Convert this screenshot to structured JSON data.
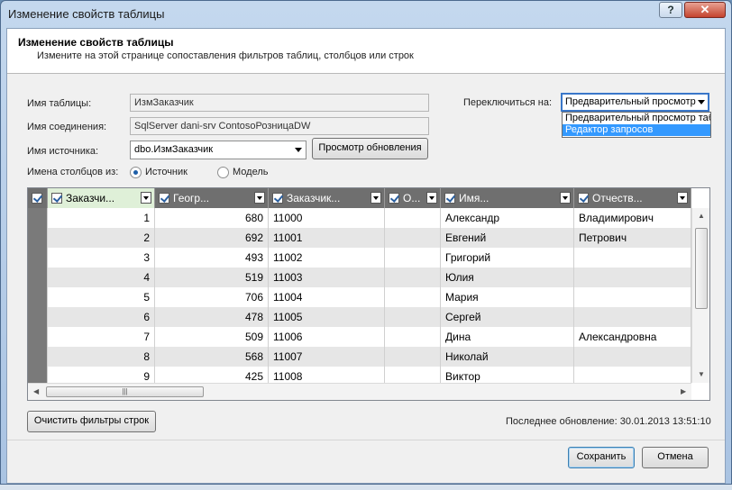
{
  "window": {
    "title": "Изменение свойств таблицы",
    "help_label": "?",
    "close_label": "✕"
  },
  "header": {
    "title": "Изменение свойств таблицы",
    "subtitle": "Измените на этой странице сопоставления фильтров таблиц, столбцов или строк"
  },
  "form": {
    "table_name_label": "Имя таблицы:",
    "table_name_value": "ИзмЗаказчик",
    "connection_label": "Имя соединения:",
    "connection_value": "SqlServer dani-srv ContosoРозницаDW",
    "source_label": "Имя источника:",
    "source_value": "dbo.ИзмЗаказчик",
    "preview_update_label": "Просмотр обновления",
    "column_names_label": "Имена столбцов из:",
    "radio_source_label": "Источник",
    "radio_model_label": "Модель",
    "switch_label": "Переключиться на:",
    "switch_value": "Предварительный просмотр",
    "switch_options": [
      "Предварительный просмотр таблиц",
      "Редактор запросов"
    ]
  },
  "grid": {
    "headers": [
      "Заказчи...",
      "Геогр...",
      "Заказчик...",
      "О...",
      "Имя...",
      "Отчеств..."
    ],
    "rows": [
      [
        "1",
        "680",
        "11000",
        "",
        "Александр",
        "Владимирович"
      ],
      [
        "2",
        "692",
        "11001",
        "",
        "Евгений",
        "Петрович"
      ],
      [
        "3",
        "493",
        "11002",
        "",
        "Григорий",
        ""
      ],
      [
        "4",
        "519",
        "11003",
        "",
        "Юлия",
        ""
      ],
      [
        "5",
        "706",
        "11004",
        "",
        "Мария",
        ""
      ],
      [
        "6",
        "478",
        "11005",
        "",
        "Сергей",
        ""
      ],
      [
        "7",
        "509",
        "11006",
        "",
        "Дина",
        "Александровна"
      ],
      [
        "8",
        "568",
        "11007",
        "",
        "Николай",
        ""
      ],
      [
        "9",
        "425",
        "11008",
        "",
        "Виктор",
        ""
      ]
    ]
  },
  "footer": {
    "clear_filters_label": "Очистить фильтры строк",
    "last_update": "Последнее обновление: 30.01.2013 13:51:10",
    "save_label": "Сохранить",
    "cancel_label": "Отмена"
  }
}
